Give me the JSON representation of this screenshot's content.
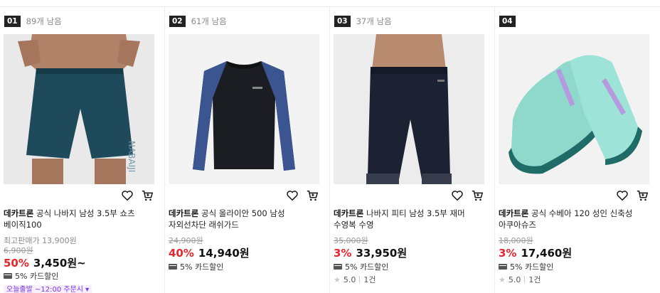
{
  "colors": {
    "discount": "#e8242c",
    "rank_bg": "#222222",
    "delivery": "#7b2ff0"
  },
  "products": [
    {
      "rank": "01",
      "stock": "89개 남음",
      "brand": "데카트론",
      "name": "공식 나바지 남성 3.5부 쇼츠 베이직100",
      "prev_label": "최고판매가 13,900원",
      "original_price": "6,900원",
      "discount": "50%",
      "price": "3,450원~",
      "card_benefit": "5% 카드할인",
      "delivery": "오늘출발 ~12:00 주문시 ▾",
      "icons": [
        "heart-icon",
        "cart-icon"
      ]
    },
    {
      "rank": "02",
      "stock": "61개 남음",
      "brand": "데카트론",
      "name": "공식 올라이안 500 남성 자외선차단 래쉬가드",
      "original_price": "24,900원",
      "discount": "40%",
      "price": "14,940원",
      "card_benefit": "5% 카드할인",
      "icons": [
        "heart-icon",
        "cart-icon"
      ]
    },
    {
      "rank": "03",
      "stock": "37개 남음",
      "brand": "데카트론",
      "name": "나바지 피티 남성 3.5부 재머 수영복 수영",
      "original_price": "35,000원",
      "discount": "3%",
      "price": "33,950원",
      "card_benefit": "5% 카드할인",
      "rating": "5.0",
      "reviews": "1건",
      "icons": [
        "heart-icon",
        "cart-icon"
      ]
    },
    {
      "rank": "04",
      "stock": "",
      "brand": "데카트론",
      "name": "공식 수베아 120 성인 신축성 아쿠아슈즈",
      "original_price": "18,000원",
      "discount": "3%",
      "price": "17,460원",
      "card_benefit": "5% 카드할인",
      "rating": "5.0",
      "reviews": "1건",
      "icons": [
        "heart-icon",
        "cart-icon"
      ]
    }
  ]
}
